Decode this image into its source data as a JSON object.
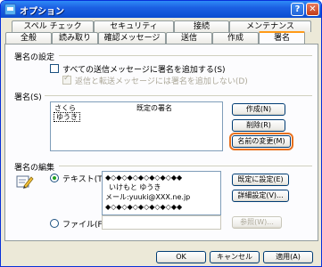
{
  "window": {
    "title": "オプション",
    "help": "?",
    "close": "✕"
  },
  "tabs_back": [
    "スペル チェック",
    "セキュリティ",
    "接続",
    "メンテナンス"
  ],
  "tabs_front": [
    "全般",
    "読み取り",
    "確認メッセージ",
    "送信",
    "作成",
    "署名"
  ],
  "active_tab": "署名",
  "settings": {
    "title": "署名の設定",
    "add_all": "すべての送信メッセージに署名を追加する(S)",
    "no_reply": "返信と転送メッセージには署名を追加しない(D)"
  },
  "signatures": {
    "title": "署名(S)",
    "rows": [
      {
        "name": "さくら",
        "default": "既定の署名"
      },
      {
        "name": "ゆうき",
        "default": ""
      }
    ],
    "btn_new": "作成(N)",
    "btn_delete": "削除(R)",
    "btn_rename": "名前の変更(M)"
  },
  "edit": {
    "title": "署名の編集",
    "text_radio": "テキスト(T)",
    "text_lines": [
      "◆◇◆◇◆◇◆◇◆◇◆◇◆◆",
      "いけもと ゆうき",
      "メール:yuuki@XXX.ne.jp",
      "◆◇◆◇◆◇◆◇◆◇◆◇◆◆"
    ],
    "btn_default": "既定に設定(E)",
    "btn_advanced": "詳細設定(V)...",
    "file_radio": "ファイル(F)",
    "btn_browse": "参照(W)..."
  },
  "buttons": {
    "ok": "OK",
    "cancel": "キャンセル",
    "apply": "適用(A)"
  },
  "colors": {
    "highlight": "#e8701d",
    "title_bar": "#0b4dd0"
  }
}
